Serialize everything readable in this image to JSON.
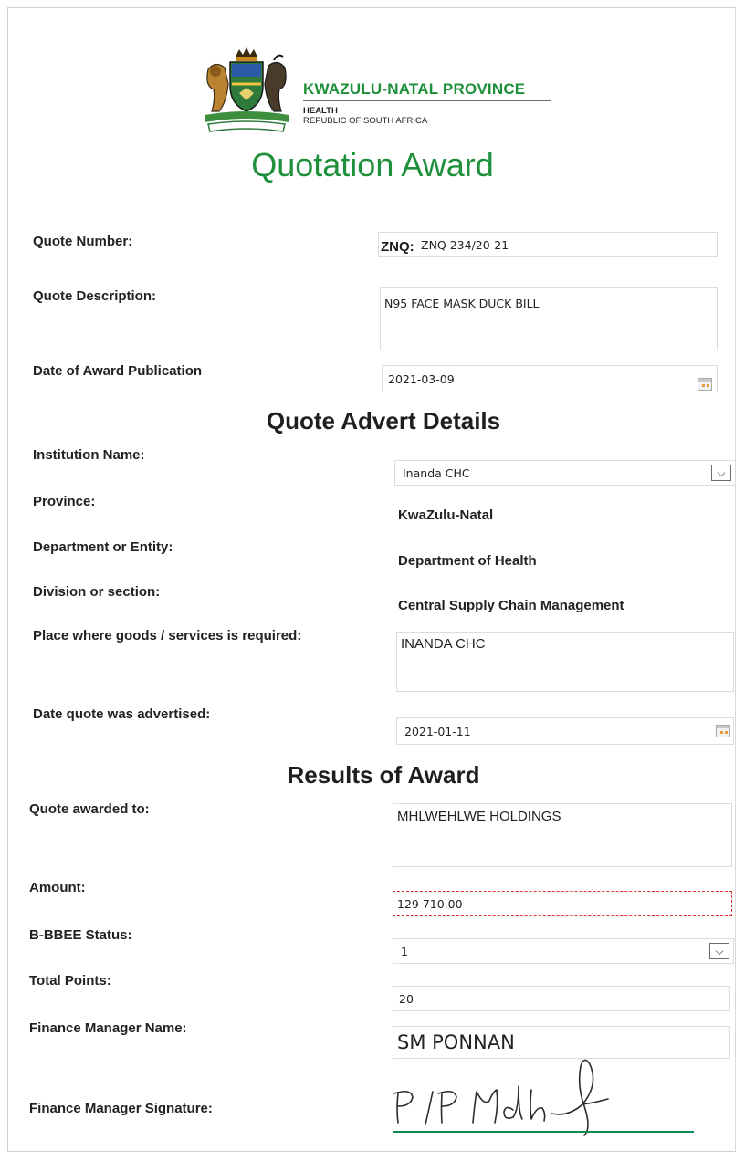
{
  "header": {
    "province_name": "KWAZULU-NATAL PROVINCE",
    "dept": "HEALTH",
    "country": "REPUBLIC OF SOUTH AFRICA",
    "title": "Quotation Award"
  },
  "quote": {
    "number_label": "Quote Number:",
    "number_prefix": "ZNQ:",
    "number_value": "ZNQ 234/20-21",
    "description_label": "Quote Description:",
    "description_value": "N95 FACE MASK DUCK BILL",
    "award_date_label": "Date of Award Publication",
    "award_date_value": "2021-03-09"
  },
  "advert": {
    "heading": "Quote Advert Details",
    "institution_label": "Institution Name:",
    "institution_value": "Inanda CHC",
    "province_label": "Province:",
    "province_value": "KwaZulu-Natal",
    "department_label": "Department or Entity:",
    "department_value": "Department of Health",
    "division_label": "Division or section:",
    "division_value": "Central Supply Chain Management",
    "place_label": "Place where goods /  services is required:",
    "place_value": "INANDA CHC",
    "advertised_label": "Date quote was advertised:",
    "advertised_value": "2021-01-11"
  },
  "results": {
    "heading": "Results of Award",
    "awarded_label": "Quote awarded to:",
    "awarded_value": "MHLWEHLWE HOLDINGS",
    "amount_label": "Amount:",
    "amount_value": "129 710.00",
    "bbbee_label": "B-BBEE Status:",
    "bbbee_value": "1",
    "points_label": "Total Points:",
    "points_value": "20",
    "manager_name_label": "Finance Manager Name:",
    "manager_name_value": "SM PONNAN",
    "manager_signature_label": "Finance Manager Signature:",
    "signature_text": "P/P"
  },
  "colors": {
    "brand_green": "#1e8f3a",
    "amount_border": "#dd3333",
    "signature_line": "#0f8a55"
  },
  "icons": [
    "coat-of-arms-logo",
    "calendar-icon",
    "dropdown-chevron-icon",
    "handwritten-signature"
  ]
}
